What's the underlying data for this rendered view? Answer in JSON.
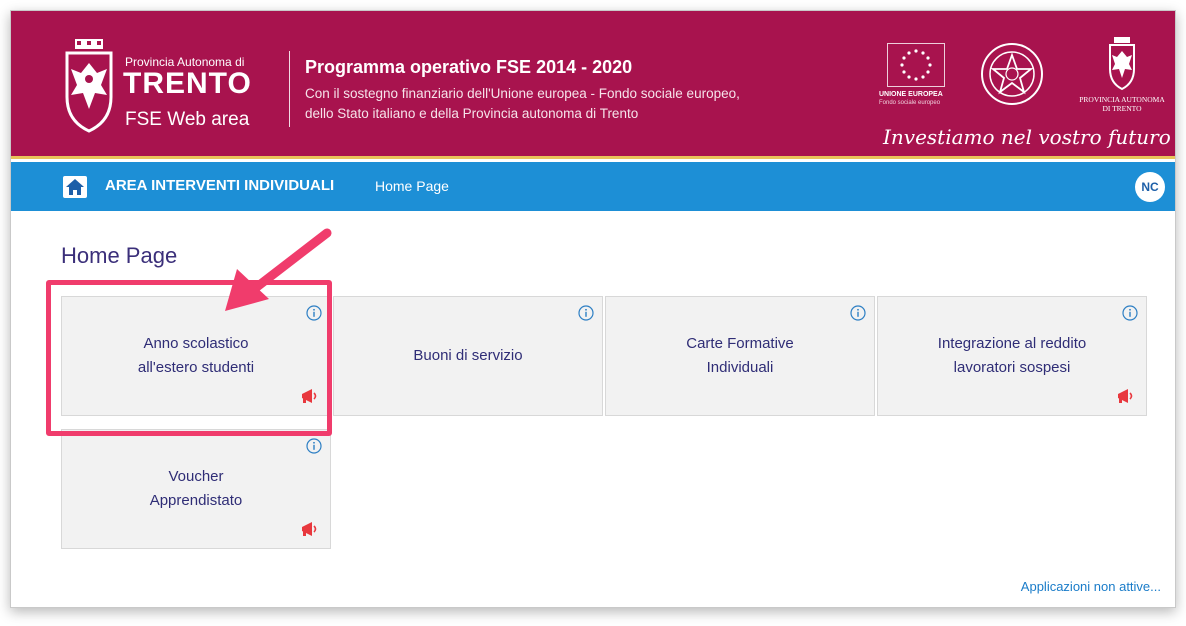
{
  "header": {
    "brand_small": "Provincia Autonoma di",
    "brand_big": "TRENTO",
    "brand_sub": "FSE Web area",
    "program_title": "Programma operativo FSE 2014 - 2020",
    "program_line1": "Con il sostegno finanziario dell'Unione europea - Fondo sociale europeo,",
    "program_line2": "dello Stato italiano e della Provincia autonoma di Trento",
    "eu_label": "UNIONE EUROPEA",
    "eu_sublabel": "Fondo sociale europeo",
    "pat_label": "PROVINCIA AUTONOMA\nDI TRENTO",
    "slogan": "Investiamo nel vostro futuro",
    "accent_color": "#a8134e"
  },
  "navbar": {
    "area": "AREA INTERVENTI INDIVIDUALI",
    "page": "Home Page",
    "avatar": "NC",
    "color": "#1d8fd6"
  },
  "main": {
    "title": "Home Page",
    "tiles": [
      {
        "label": "Anno scolastico\nall'estero studenti",
        "info_icon": "info-icon",
        "megaphone": true,
        "highlighted": true
      },
      {
        "label": "Buoni di servizio",
        "info_icon": "info-icon",
        "megaphone": false
      },
      {
        "label": "Carte Formative\nIndividuali",
        "info_icon": "info-icon",
        "megaphone": false
      },
      {
        "label": "Integrazione al reddito\nlavoratori sospesi",
        "info_icon": "info-icon",
        "megaphone": true
      },
      {
        "label": "Voucher\nApprendistato",
        "info_icon": "info-icon",
        "megaphone": true
      }
    ],
    "footer_link": "Applicazioni non attive..."
  },
  "annotation_color": "#f03c6c"
}
